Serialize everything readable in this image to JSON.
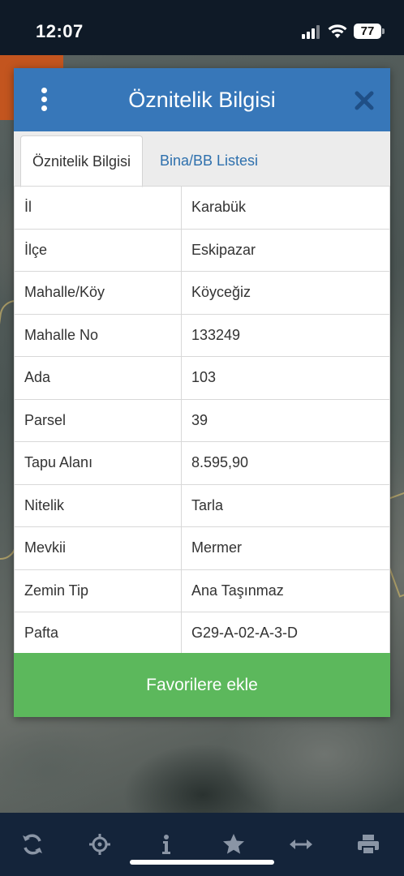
{
  "status_bar": {
    "time": "12:07",
    "battery": "77"
  },
  "modal": {
    "title": "Öznitelik Bilgisi",
    "tabs": [
      {
        "label": "Öznitelik Bilgisi",
        "active": true
      },
      {
        "label": "Bina/BB Listesi",
        "active": false
      }
    ],
    "rows": [
      {
        "key": "İl",
        "value": "Karabük"
      },
      {
        "key": "İlçe",
        "value": "Eskipazar"
      },
      {
        "key": "Mahalle/Köy",
        "value": "Köyceğiz"
      },
      {
        "key": "Mahalle No",
        "value": "133249"
      },
      {
        "key": "Ada",
        "value": "103"
      },
      {
        "key": "Parsel",
        "value": "39"
      },
      {
        "key": "Tapu Alanı",
        "value": "8.595,90"
      },
      {
        "key": "Nitelik",
        "value": "Tarla"
      },
      {
        "key": "Mevkii",
        "value": "Mermer"
      },
      {
        "key": "Zemin Tip",
        "value": "Ana Taşınmaz"
      },
      {
        "key": "Pafta",
        "value": "G29-A-02-A-3-D"
      }
    ],
    "favorite_button": "Favorilere ekle"
  },
  "toolbar": {
    "icons": [
      "refresh-icon",
      "locate-icon",
      "info-icon",
      "star-icon",
      "measure-icon",
      "print-icon"
    ]
  },
  "colors": {
    "header": "#3777b9",
    "favorite": "#5cb85c",
    "toolbar": "#14243a",
    "tab_link": "#2e70ad"
  }
}
